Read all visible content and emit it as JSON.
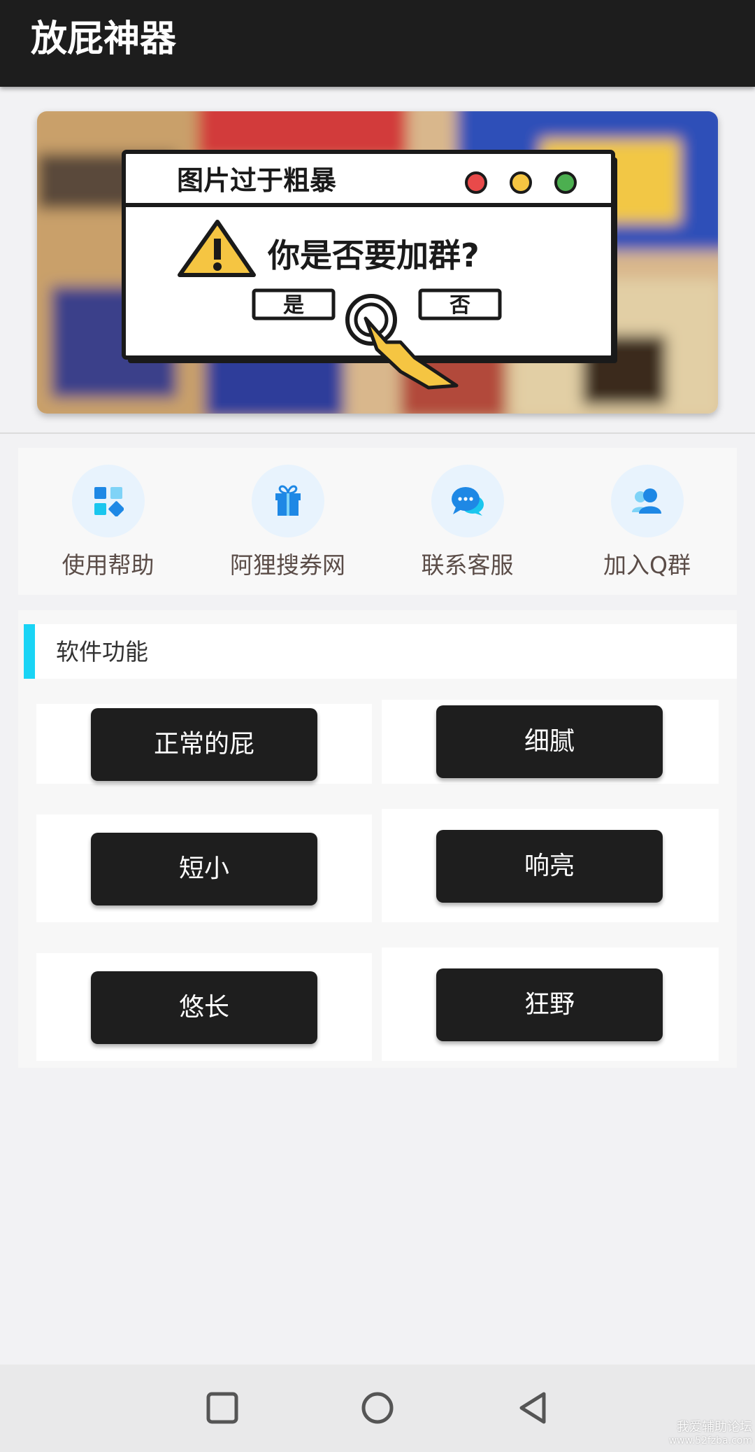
{
  "appbar": {
    "title": "放屁神器"
  },
  "banner": {
    "window_title": "图片过于粗暴",
    "question": "你是否要加群?",
    "yes_label": "是",
    "no_label": "否",
    "dot_colors": [
      "#e84a4a",
      "#f5c542",
      "#4caf50"
    ]
  },
  "quick_links": [
    {
      "label": "使用帮助",
      "icon": "grid-apps-icon"
    },
    {
      "label": "阿狸搜券网",
      "icon": "gift-icon"
    },
    {
      "label": "联系客服",
      "icon": "chat-bubbles-icon"
    },
    {
      "label": "加入Q群",
      "icon": "user-group-icon"
    }
  ],
  "features": {
    "title": "软件功能",
    "buttons": [
      "正常的屁",
      "细腻",
      "短小",
      "响亮",
      "悠长",
      "狂野"
    ]
  },
  "navbar": {
    "icons": [
      "recent-apps-icon",
      "home-icon",
      "back-icon"
    ]
  },
  "watermark": {
    "line1": "我爱辅助论坛",
    "line2": "www.52fzba.com"
  },
  "colors": {
    "appbar": "#1d1d1d",
    "accent": "#1ad4f5",
    "button": "#1e1e1e",
    "icon_blue": "#1e88e5"
  }
}
